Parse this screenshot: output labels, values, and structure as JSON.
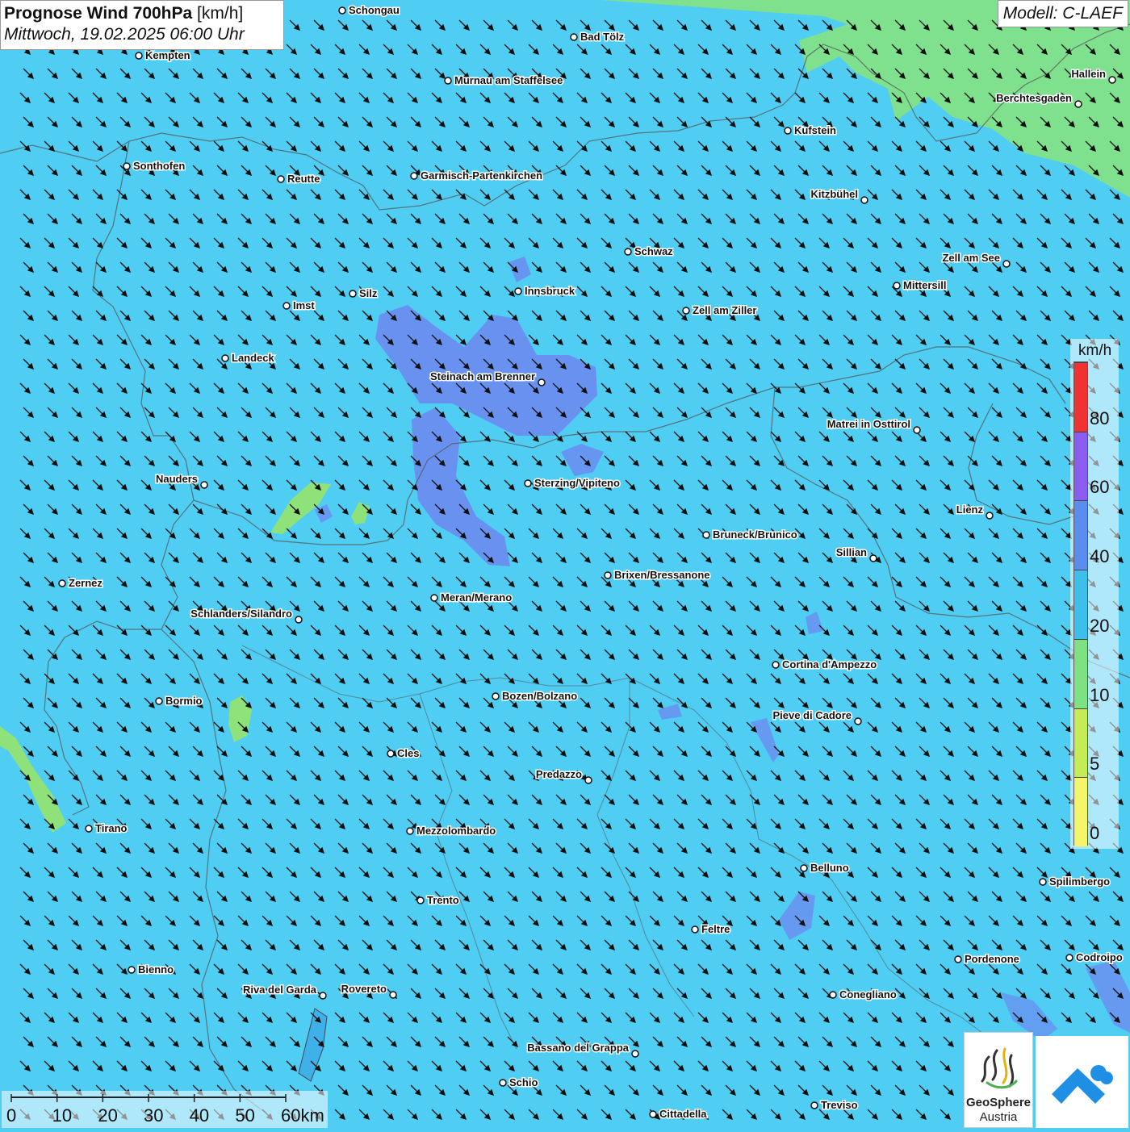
{
  "title": {
    "main_bold": "Prognose Wind 700hPa",
    "main_unit": "[km/h]",
    "date": "Mittwoch, 19.02.2025 06:00 Uhr"
  },
  "model": "Modell: C-LAEF",
  "legend": {
    "unit": "km/h",
    "ticks": [
      "0",
      "5",
      "10",
      "20",
      "40",
      "60",
      "80"
    ],
    "colors": [
      "#f5f56a",
      "#c6ec55",
      "#7ee285",
      "#3ebeea",
      "#5b8cf0",
      "#8a5cf0",
      "#f03232"
    ]
  },
  "scalebar": {
    "labels": [
      "0",
      "10",
      "20",
      "30",
      "40",
      "50",
      "60km"
    ]
  },
  "logos": {
    "geosphere_line1": "GeoSphere",
    "geosphere_line2": "Austria"
  },
  "cities": [
    {
      "name": "Schongau",
      "label_side": "right"
    },
    {
      "name": "Bad Tölz",
      "label_side": "right"
    },
    {
      "name": "Kempten",
      "label_side": "right"
    },
    {
      "name": "Murnau am Staffelsee",
      "label_side": "right"
    },
    {
      "name": "Hallein",
      "label_side": "left"
    },
    {
      "name": "Berchtesgaden",
      "label_side": "left"
    },
    {
      "name": "Kufstein",
      "label_side": "right"
    },
    {
      "name": "Sonthofen",
      "label_side": "right"
    },
    {
      "name": "Reutte",
      "label_side": "right"
    },
    {
      "name": "Garmisch-Partenkirchen",
      "label_side": "right"
    },
    {
      "name": "Kitzbühel",
      "label_side": "left"
    },
    {
      "name": "Schwaz",
      "label_side": "right"
    },
    {
      "name": "Zell am See",
      "label_side": "left"
    },
    {
      "name": "Innsbruck",
      "label_side": "right"
    },
    {
      "name": "Mittersill",
      "label_side": "right"
    },
    {
      "name": "Silz",
      "label_side": "right"
    },
    {
      "name": "Imst",
      "label_side": "right"
    },
    {
      "name": "Zell am Ziller",
      "label_side": "right"
    },
    {
      "name": "Landeck",
      "label_side": "right"
    },
    {
      "name": "Steinach am Brenner",
      "label_side": "left"
    },
    {
      "name": "Matrei in Osttirol",
      "label_side": "left"
    },
    {
      "name": "Nauders",
      "label_side": "left"
    },
    {
      "name": "Sterzing/Vipiteno",
      "label_side": "right"
    },
    {
      "name": "Lienz",
      "label_side": "left"
    },
    {
      "name": "Bruneck/Brunico",
      "label_side": "right"
    },
    {
      "name": "Sillian",
      "label_side": "left"
    },
    {
      "name": "Zernez",
      "label_side": "right"
    },
    {
      "name": "Brixen/Bressanone",
      "label_side": "right"
    },
    {
      "name": "Meran/Merano",
      "label_side": "right"
    },
    {
      "name": "Schlanders/Silandro",
      "label_side": "left"
    },
    {
      "name": "Cortina d'Ampezzo",
      "label_side": "right"
    },
    {
      "name": "Bozen/Bolzano",
      "label_side": "right"
    },
    {
      "name": "Bormio",
      "label_side": "right"
    },
    {
      "name": "Pieve di Cadore",
      "label_side": "left"
    },
    {
      "name": "Cles",
      "label_side": "right"
    },
    {
      "name": "Predazzo",
      "label_side": "left"
    },
    {
      "name": "Tirano",
      "label_side": "right"
    },
    {
      "name": "Mezzolombardo",
      "label_side": "right"
    },
    {
      "name": "Belluno",
      "label_side": "right"
    },
    {
      "name": "Spilimbergo",
      "label_side": "right"
    },
    {
      "name": "Trento",
      "label_side": "right"
    },
    {
      "name": "Feltre",
      "label_side": "right"
    },
    {
      "name": "Bienno",
      "label_side": "right"
    },
    {
      "name": "Pordenone",
      "label_side": "right"
    },
    {
      "name": "Codroipo",
      "label_side": "right"
    },
    {
      "name": "Riva del Garda",
      "label_side": "left"
    },
    {
      "name": "Rovereto",
      "label_side": "left"
    },
    {
      "name": "Conegliano",
      "label_side": "right"
    },
    {
      "name": "Bassano del Grappa",
      "label_side": "left"
    },
    {
      "name": "Schio",
      "label_side": "right"
    },
    {
      "name": "Treviso",
      "label_side": "right"
    },
    {
      "name": "Cittadella",
      "label_side": "right"
    }
  ],
  "wind": {
    "direction_deg_from": 315,
    "field_class_background": "20-40 km/h"
  }
}
